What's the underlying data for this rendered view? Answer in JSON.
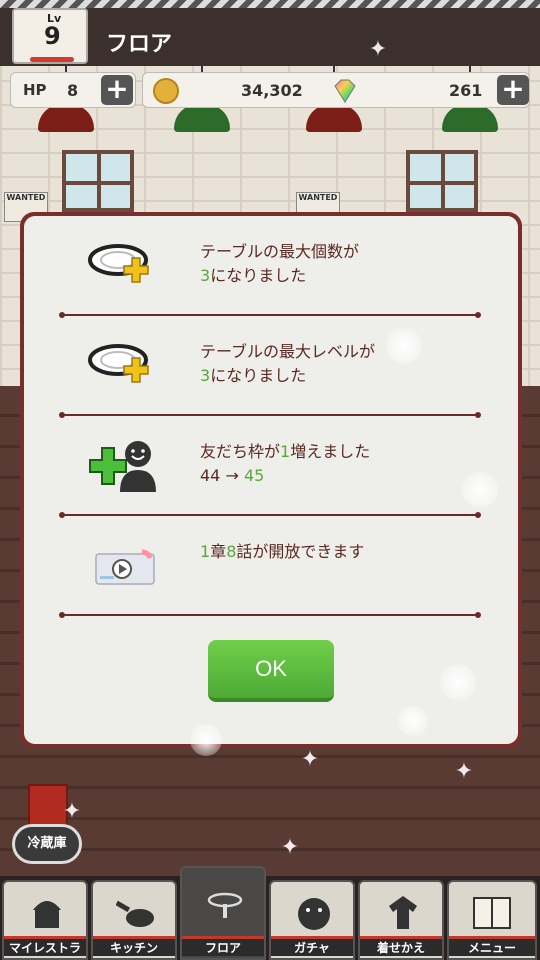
{
  "header": {
    "level_label": "Lv",
    "level": "9",
    "title": "フロア"
  },
  "resources": {
    "hp_label": "HP",
    "hp_value": "8",
    "coins": "34,302",
    "gems": "261",
    "plus_symbol": "+"
  },
  "background": {
    "poster_text": "WANTED"
  },
  "dialog": {
    "rows": [
      {
        "icon": "plate-plus-icon",
        "line1": "テーブルの最大個数が",
        "num": "3",
        "line2_rest": "になりました"
      },
      {
        "icon": "plate-plus-icon",
        "line1": "テーブルの最大レベルが",
        "num": "3",
        "line2_rest": "になりました"
      },
      {
        "icon": "add-friend-icon",
        "line1_pre": "友だち枠が",
        "line1_num": "1",
        "line1_post": "増えました",
        "line2_old": "44",
        "line2_arrow": "→",
        "line2_new": "45"
      },
      {
        "icon": "video-ticket-icon",
        "ch": "1",
        "ch_label": "章",
        "ep": "8",
        "ep_label": "話が開放できます"
      }
    ],
    "ok_label": "OK"
  },
  "fridge_label": "冷蔵庫",
  "nav": [
    {
      "id": "my-restaurant",
      "label": "マイレストラン",
      "icon": "restaurant-icon"
    },
    {
      "id": "kitchen",
      "label": "キッチン",
      "icon": "frying-pan-icon"
    },
    {
      "id": "floor",
      "label": "フロア",
      "icon": "table-icon",
      "active": true
    },
    {
      "id": "gacha",
      "label": "ガチャ",
      "icon": "gacha-ball-icon"
    },
    {
      "id": "dress-up",
      "label": "着せかえ",
      "icon": "dress-up-icon"
    },
    {
      "id": "menu",
      "label": "メニュー",
      "icon": "menu-book-icon"
    }
  ],
  "colors": {
    "accent_green": "#5aa83a",
    "dialog_border": "#7a2e2c",
    "text_brown": "#5a2a22",
    "ok_button": "#5cbd3e"
  }
}
